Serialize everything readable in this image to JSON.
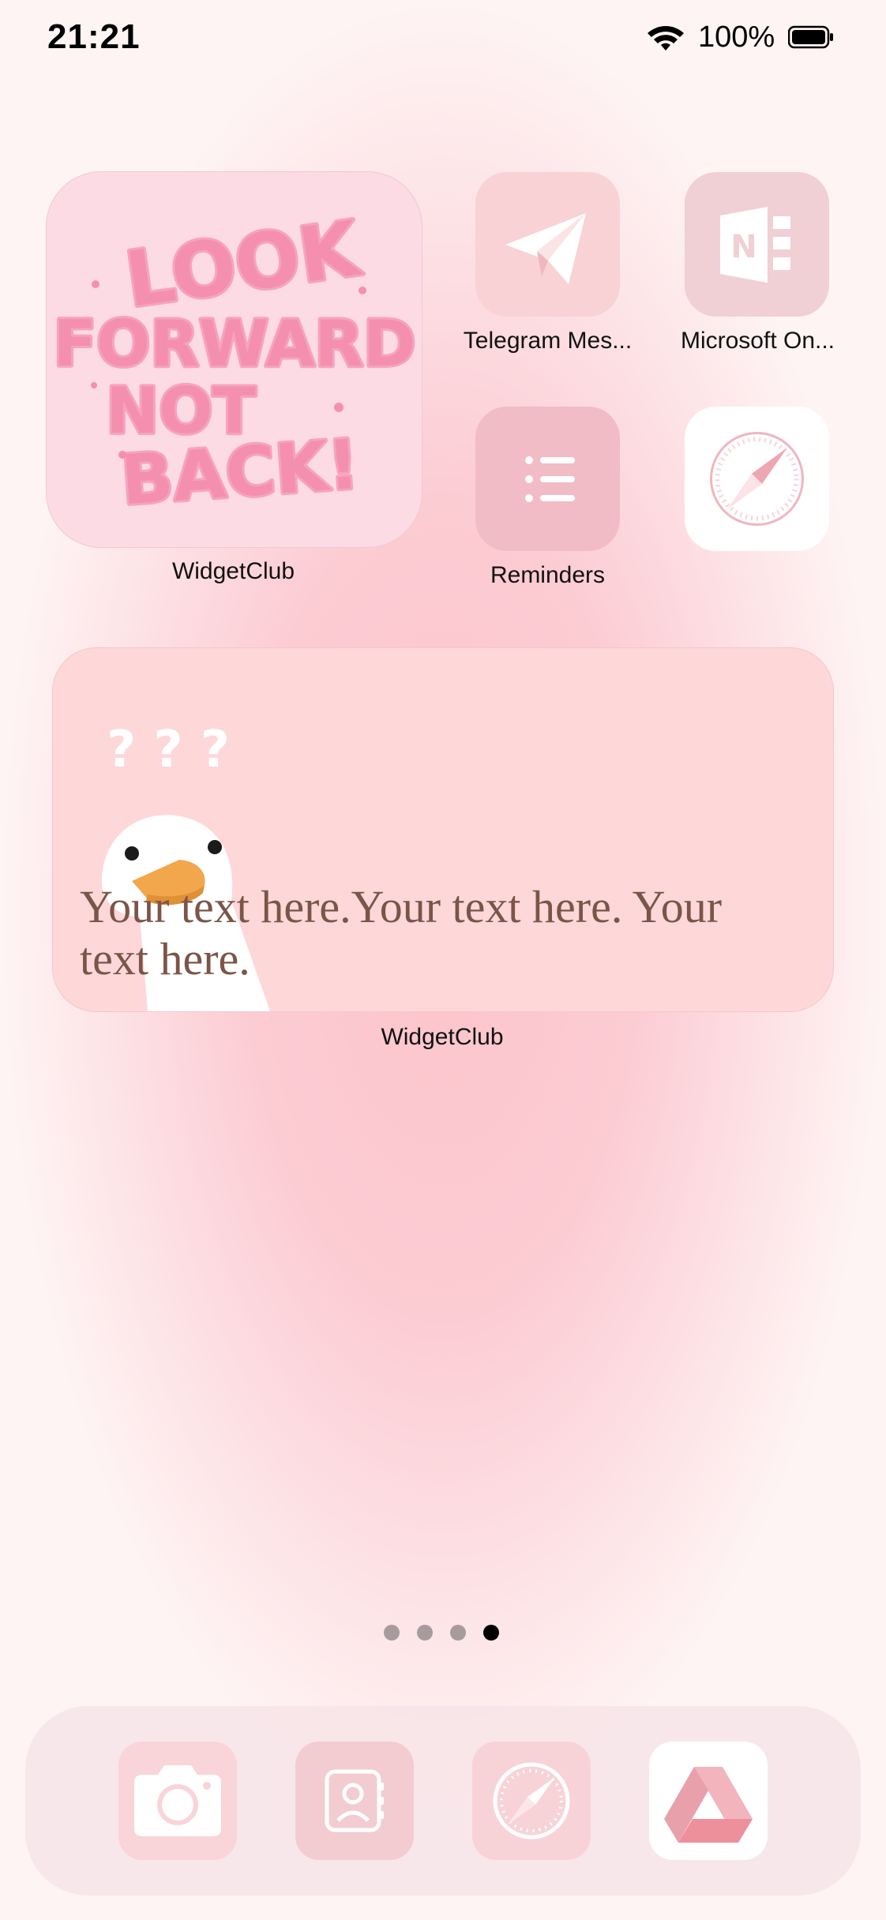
{
  "status_bar": {
    "time": "21:21",
    "battery": "100%"
  },
  "widgets": {
    "top": {
      "label": "WidgetClub",
      "art_text": [
        "LOOK",
        "FORWARD",
        "NOT",
        "BACK!"
      ]
    },
    "wide": {
      "label": "WidgetClub",
      "text": "Your text here.Your text here. Your text here.",
      "marks": "? ? ?"
    }
  },
  "apps": [
    {
      "label": "Telegram Mes...",
      "icon": "telegram-icon",
      "color": "#f8d2d4"
    },
    {
      "label": "Microsoft On...",
      "icon": "onenote-icon",
      "color": "#f0d0d5"
    },
    {
      "label": "Reminders",
      "icon": "reminders-icon",
      "color": "#f1bcc5"
    },
    {
      "label": "",
      "icon": "safari-icon",
      "color": "#ffffff"
    }
  ],
  "page_dots": {
    "count": 4,
    "active": 4
  },
  "dock": [
    {
      "icon": "camera-icon",
      "color": "#f9d4d9"
    },
    {
      "icon": "contacts-icon",
      "color": "#f2ccd1"
    },
    {
      "icon": "safari-icon",
      "color": "#f7d3d8"
    },
    {
      "icon": "drive-icon",
      "color": "#ffffff"
    }
  ]
}
